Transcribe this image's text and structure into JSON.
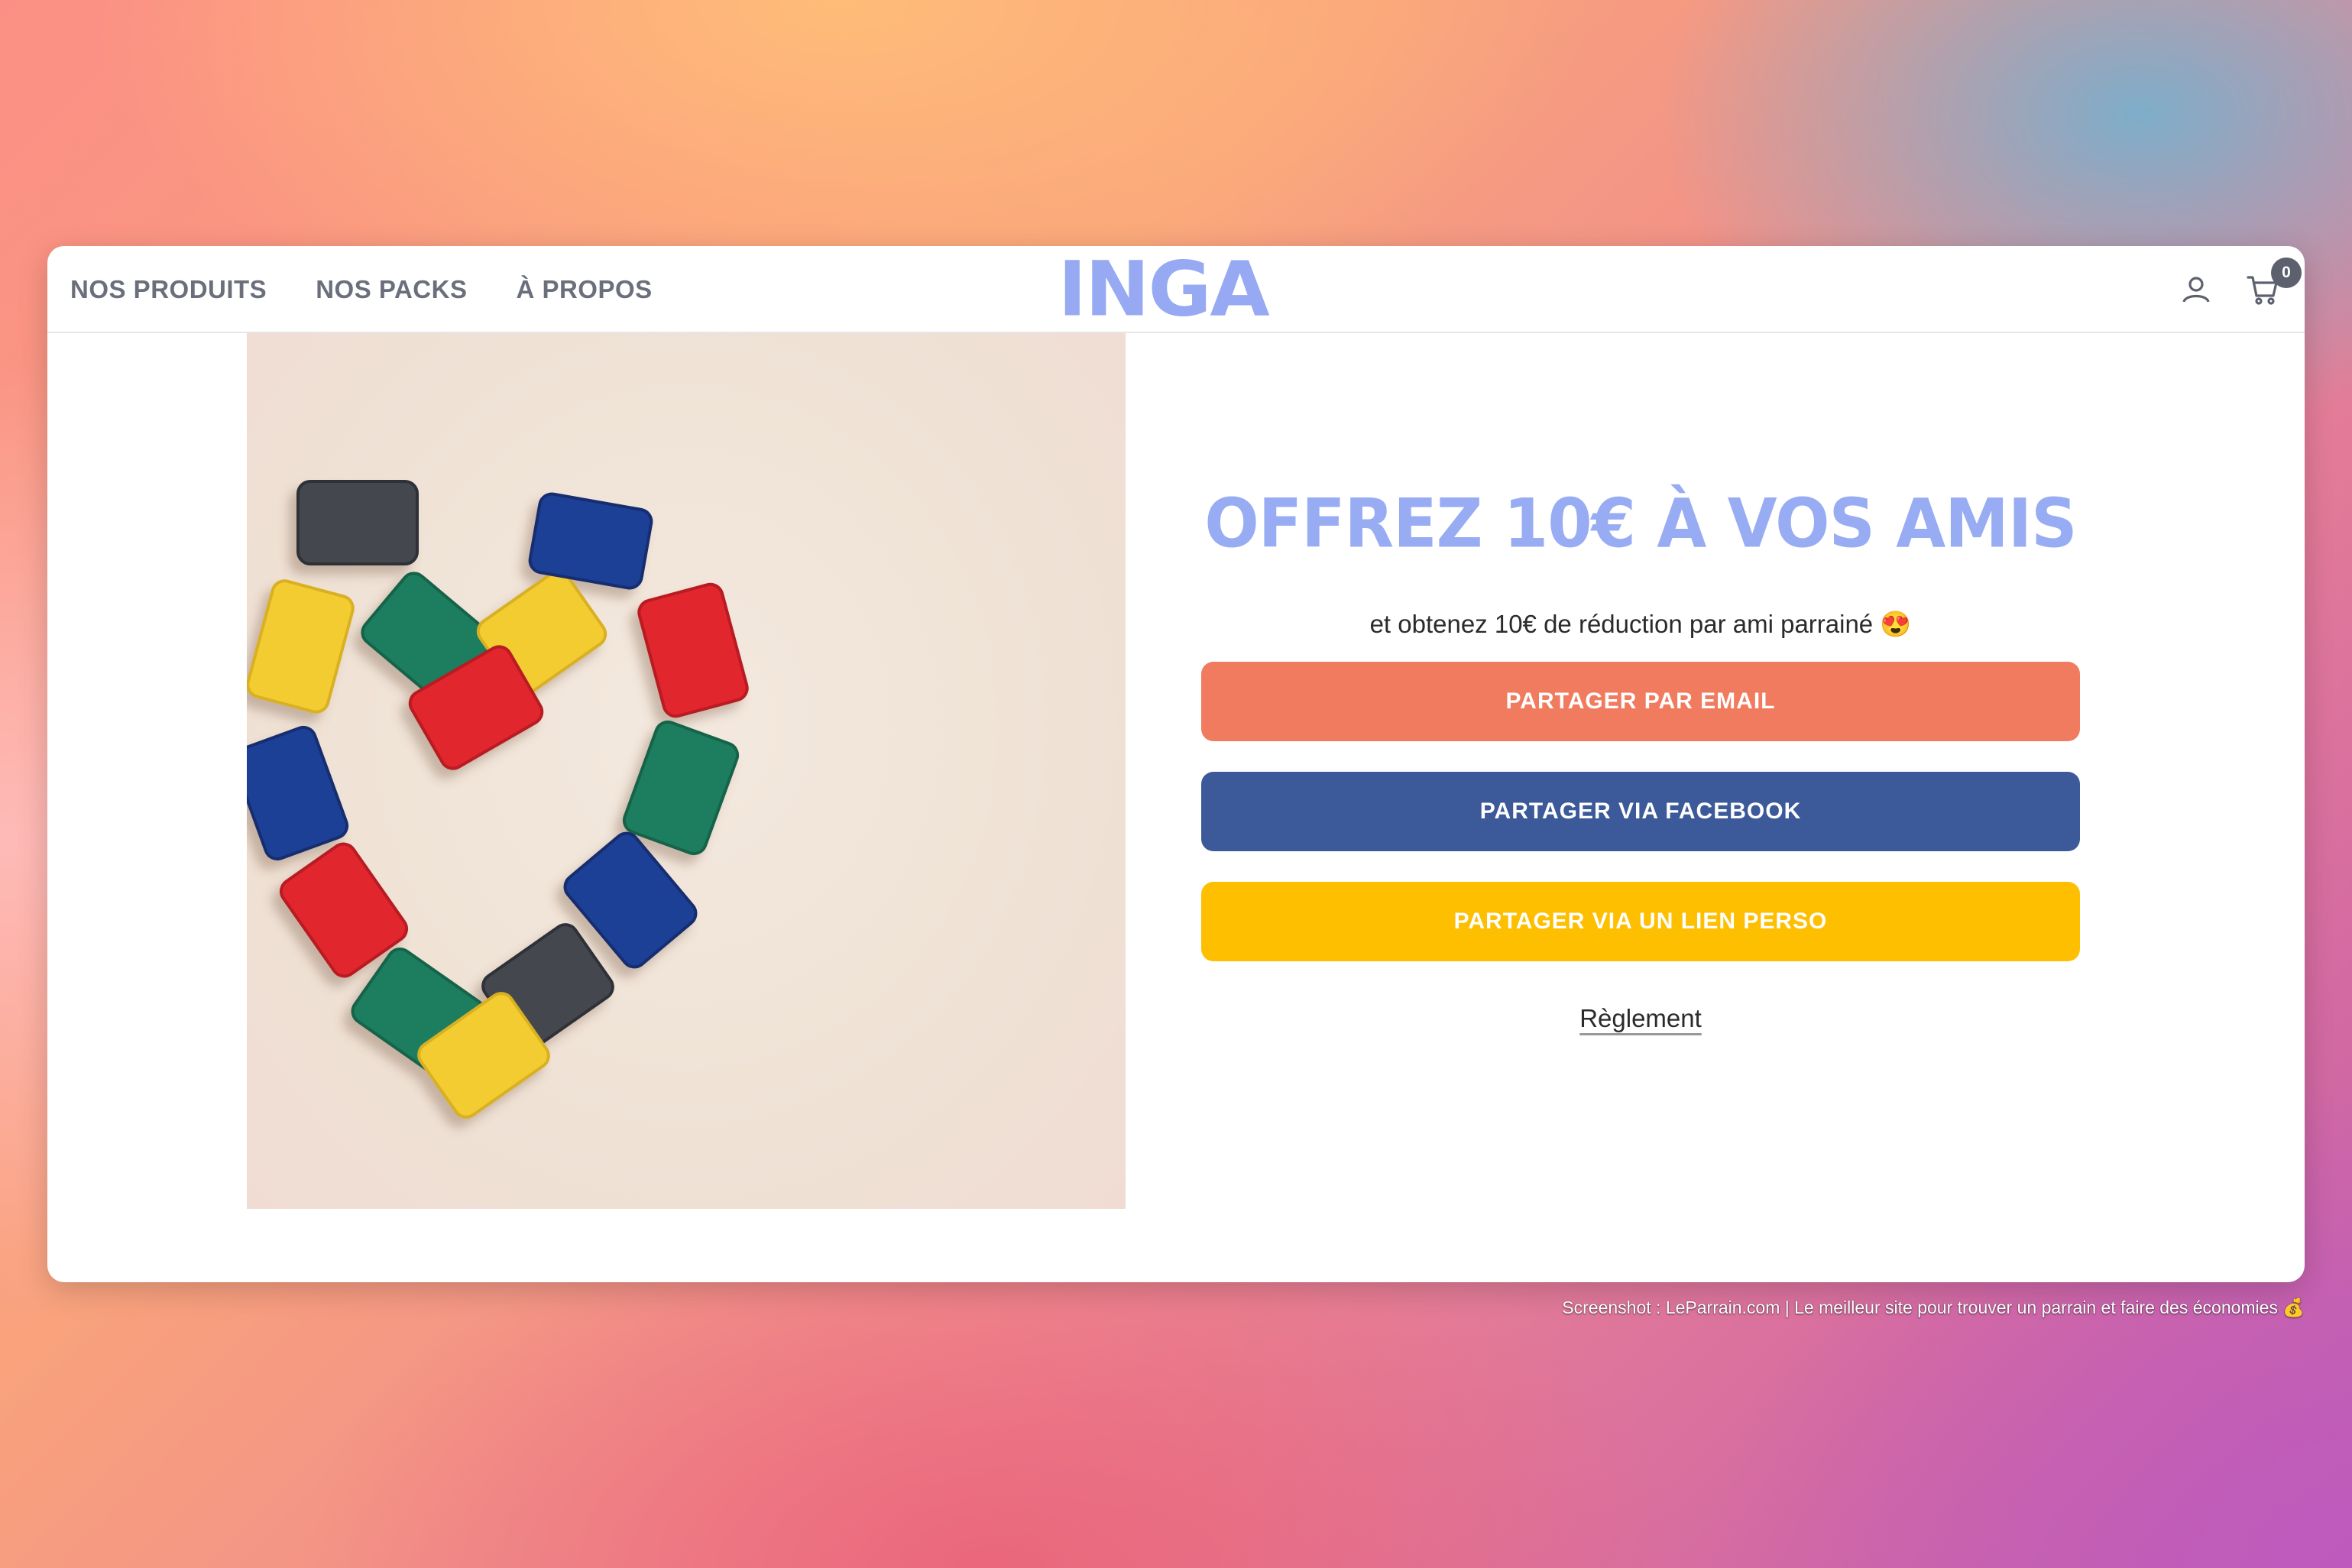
{
  "header": {
    "nav": [
      {
        "label": "NOS PRODUITS"
      },
      {
        "label": "NOS PACKS"
      },
      {
        "label": "À PROPOS"
      }
    ],
    "logo": "INGA",
    "account_icon": "user-icon",
    "cart_icon": "cart-icon",
    "cart_count": "0"
  },
  "hero": {
    "image_subject": "heart-of-colored-bean-bags",
    "headline": "OFFREZ 10€ À VOS AMIS",
    "subtitle": "et obtenez 10€ de réduction par ami parrainé 😍",
    "buttons": {
      "email": "PARTAGER PAR EMAIL",
      "facebook": "PARTAGER VIA FACEBOOK",
      "link": "PARTAGER VIA UN LIEN PERSO"
    },
    "rules_link": "Règlement"
  },
  "colors": {
    "brand": "#96a9f2",
    "email_button": "#f07b5e",
    "facebook_button": "#3c5a99",
    "link_button": "#fdbf00"
  },
  "caption": "Screenshot : LeParrain.com | Le meilleur site pour trouver un parrain et faire des économies 💰"
}
